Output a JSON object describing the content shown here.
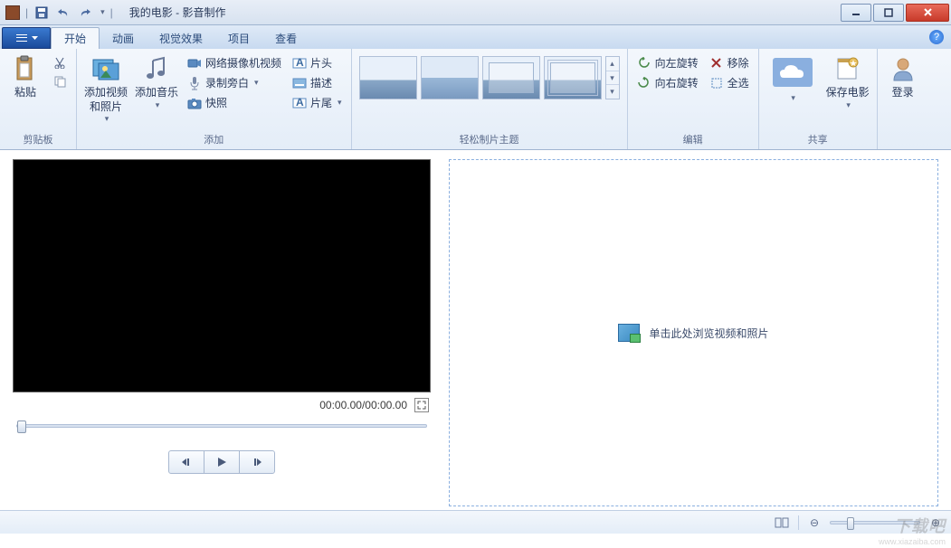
{
  "titlebar": {
    "title": "我的电影 - 影音制作",
    "qat": {
      "save": "保存",
      "undo": "撤销",
      "redo": "重做"
    }
  },
  "tabs": {
    "file": "文件",
    "home": "开始",
    "animations": "动画",
    "visual_effects": "视觉效果",
    "project": "项目",
    "view": "查看"
  },
  "ribbon": {
    "clipboard": {
      "group": "剪贴板",
      "paste": "粘贴",
      "cut": "剪切",
      "copy": "复制"
    },
    "add": {
      "group": "添加",
      "add_videos_photos": "添加视频\n和照片",
      "add_music": "添加音乐",
      "webcam_video": "网络摄像机视频",
      "record_narration": "录制旁白",
      "snapshot": "快照",
      "title": "片头",
      "caption": "描述",
      "credits": "片尾"
    },
    "themes": {
      "group": "轻松制片主题"
    },
    "edit": {
      "group": "编辑",
      "rotate_left": "向左旋转",
      "rotate_right": "向右旋转",
      "remove": "移除",
      "select_all": "全选"
    },
    "share": {
      "group": "共享",
      "save_movie": "保存电影"
    },
    "signin": {
      "group": "",
      "signin": "登录"
    }
  },
  "preview": {
    "time": "00:00.00/00:00.00",
    "prev": "上一帧",
    "play": "播放",
    "next": "下一帧",
    "fullscreen": "全屏"
  },
  "storyboard": {
    "placeholder": "单击此处浏览视频和照片"
  },
  "statusbar": {
    "zoom_out": "-",
    "zoom_in": "+"
  },
  "watermark": {
    "main": "下载吧",
    "sub": "www.xiazaiba.com"
  }
}
